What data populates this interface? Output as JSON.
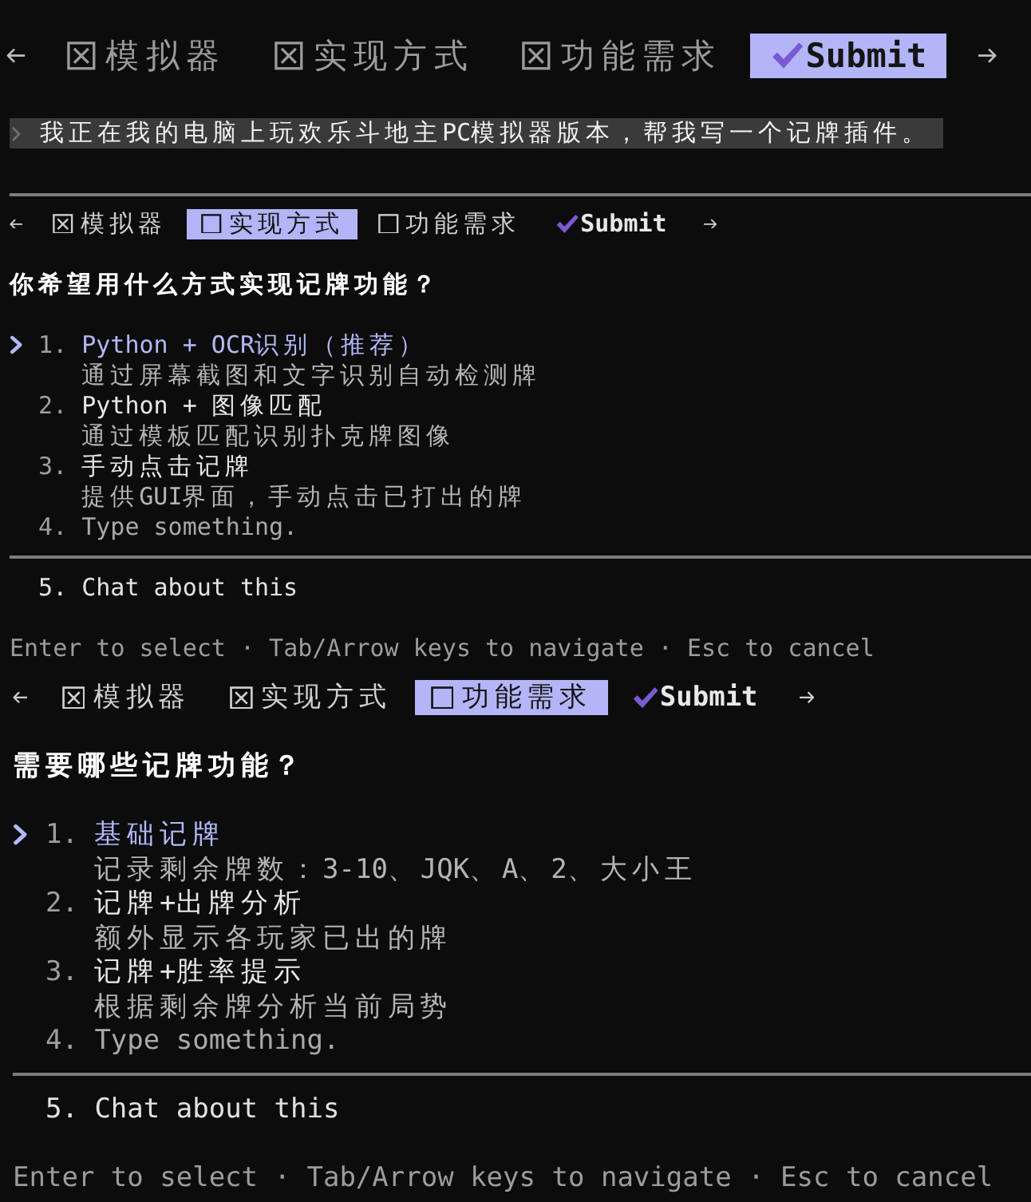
{
  "top_bar": {
    "tabs": [
      {
        "kind": "question",
        "label": "模拟器",
        "checked": true,
        "selected": false
      },
      {
        "kind": "question",
        "label": "实现方式",
        "checked": true,
        "selected": false
      },
      {
        "kind": "question",
        "label": "功能需求",
        "checked": true,
        "selected": false
      },
      {
        "kind": "submit",
        "label": "Submit",
        "selected": true
      }
    ]
  },
  "prompt": {
    "text": "我正在我的电脑上玩欢乐斗地主PC模拟器版本，帮我写一个记牌插件。"
  },
  "question_panels": [
    {
      "tabs": [
        {
          "kind": "question",
          "label": "模拟器",
          "checked": true,
          "selected": false
        },
        {
          "kind": "question",
          "label": "实现方式",
          "checked": false,
          "selected": true
        },
        {
          "kind": "question",
          "label": "功能需求",
          "checked": false,
          "selected": false
        },
        {
          "kind": "submit",
          "label": "Submit",
          "selected": false
        }
      ],
      "question": "你希望用什么方式实现记牌功能？",
      "options": [
        {
          "kind": "choice",
          "number": "1.",
          "label": "Python + OCR识别（推荐）",
          "description": "通过屏幕截图和文字识别自动检测牌",
          "selected": true
        },
        {
          "kind": "choice",
          "number": "2.",
          "label": "Python + 图像匹配",
          "description": "通过模板匹配识别扑克牌图像",
          "selected": false
        },
        {
          "kind": "choice",
          "number": "3.",
          "label": "手动点击记牌",
          "description": "提供GUI界面，手动点击已打出的牌",
          "selected": false
        },
        {
          "kind": "input",
          "number": "4.",
          "placeholder": "Type something.",
          "selected": false
        }
      ],
      "chat_option": {
        "number": "5.",
        "label": "Chat about this",
        "selected": false
      },
      "footer": "Enter to select · Tab/Arrow keys to navigate · Esc to cancel"
    },
    {
      "tabs": [
        {
          "kind": "question",
          "label": "模拟器",
          "checked": true,
          "selected": false
        },
        {
          "kind": "question",
          "label": "实现方式",
          "checked": true,
          "selected": false
        },
        {
          "kind": "question",
          "label": "功能需求",
          "checked": false,
          "selected": true
        },
        {
          "kind": "submit",
          "label": "Submit",
          "selected": false
        }
      ],
      "question": "需要哪些记牌功能？",
      "options": [
        {
          "kind": "choice",
          "number": "1.",
          "label": "基础记牌",
          "description": "记录剩余牌数：3-10、JQK、A、2、大小王",
          "selected": true
        },
        {
          "kind": "choice",
          "number": "2.",
          "label": "记牌+出牌分析",
          "description": "额外显示各玩家已出的牌",
          "selected": false
        },
        {
          "kind": "choice",
          "number": "3.",
          "label": "记牌+胜率提示",
          "description": "根据剩余牌分析当前局势",
          "selected": false
        },
        {
          "kind": "input",
          "number": "4.",
          "placeholder": "Type something.",
          "selected": false
        }
      ],
      "chat_option": {
        "number": "5.",
        "label": "Chat about this",
        "selected": false
      },
      "footer": "Enter to select · Tab/Arrow keys to navigate · Esc to cancel"
    }
  ]
}
